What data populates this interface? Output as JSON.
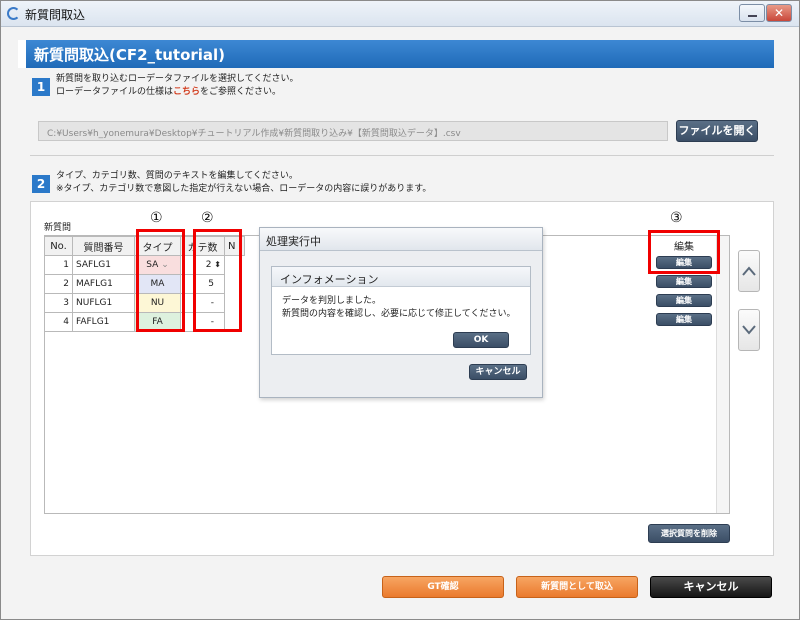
{
  "window": {
    "title": "新質問取込"
  },
  "header": {
    "title": "新質問取込(CF2_tutorial)"
  },
  "step1": {
    "number": "1",
    "line1": "新質問を取り込むローデータファイルを選択してください。",
    "line2_pre": "ローデータファイルの仕様は",
    "line2_link": "こちら",
    "line2_post": "をご参照ください。",
    "file_path": "C:¥Users¥h_yonemura¥Desktop¥チュートリアル作成¥新質問取り込み¥【新質問取込データ】.csv",
    "open_button": "ファイルを開く"
  },
  "step2": {
    "number": "2",
    "line1": "タイプ、カテゴリ数、質問のテキストを編集してください。",
    "line2": "※タイプ、カテゴリ数で意図した指定が行えない場合、ローデータの内容に誤りがあります。"
  },
  "table": {
    "section_label": "新質問",
    "markers": [
      "①",
      "②",
      "③"
    ],
    "headers": {
      "no": "No.",
      "id": "質問番号",
      "type": "タイプ",
      "categories": "カテ数",
      "text_partial": "N",
      "edit": "編集"
    },
    "rows": [
      {
        "no": "1",
        "id": "SAFLG1",
        "type": "SA",
        "categories": "2"
      },
      {
        "no": "2",
        "id": "MAFLG1",
        "type": "MA",
        "categories": "5"
      },
      {
        "no": "3",
        "id": "NUFLG1",
        "type": "NU",
        "categories": "-"
      },
      {
        "no": "4",
        "id": "FAFLG1",
        "type": "FA",
        "categories": "-"
      }
    ],
    "edit_button": "編集",
    "delete_button": "選択質問を削除",
    "scroll_up": "^",
    "scroll_down": "v"
  },
  "processing_dialog": {
    "title": "処理実行中",
    "cancel_button": "キャンセル"
  },
  "info_dialog": {
    "title": "インフォメーション",
    "message1": "データを判別しました。",
    "message2": "新質問の内容を確認し、必要に応じて修正してください。",
    "ok_button": "OK"
  },
  "footer": {
    "gt_button": "GT確認",
    "import_button": "新質問として取込",
    "cancel_button": "キャンセル"
  }
}
